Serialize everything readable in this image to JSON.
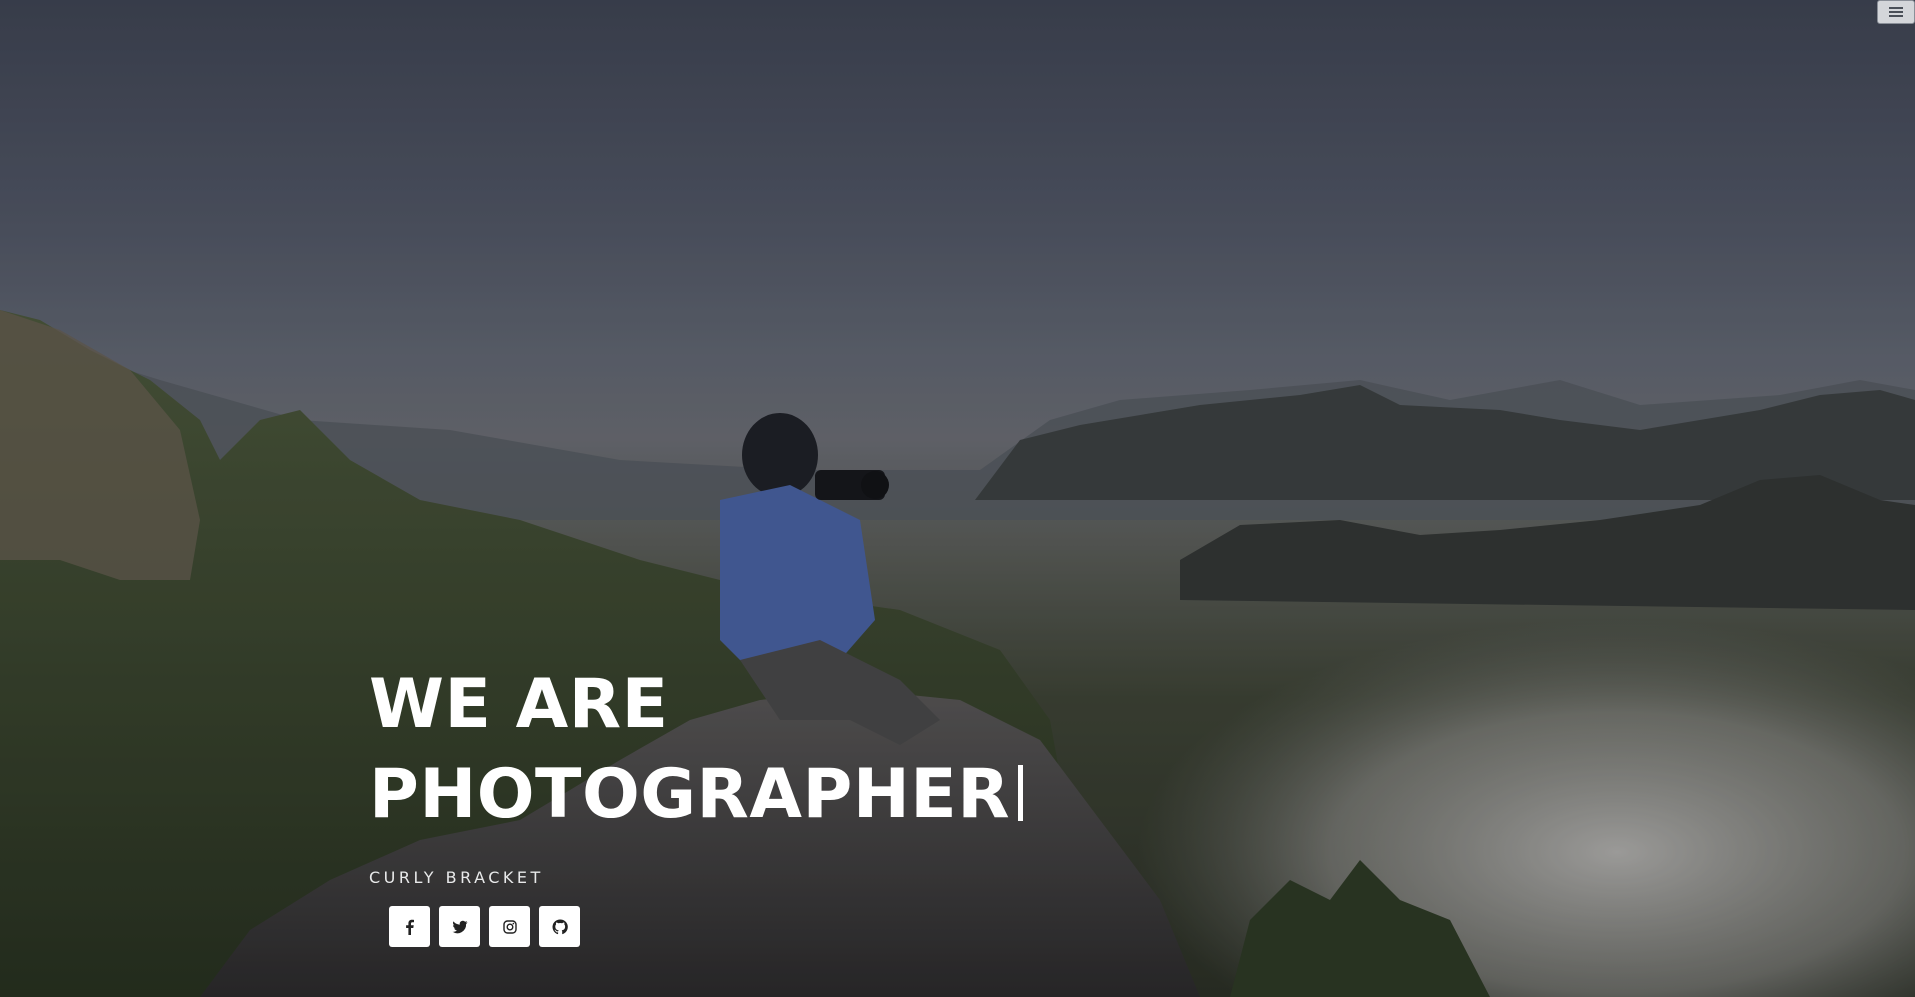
{
  "hero": {
    "headline_line1": "WE ARE",
    "headline_line2": "PHOTOGRAPHER",
    "subtitle": "CURLY BRACKET"
  },
  "nav": {
    "menu_icon": "hamburger-icon"
  },
  "social": [
    {
      "icon": "facebook-icon"
    },
    {
      "icon": "twitter-icon"
    },
    {
      "icon": "instagram-icon"
    },
    {
      "icon": "github-icon"
    }
  ],
  "colors": {
    "text": "#ffffff",
    "button_bg": "#ffffff",
    "icon": "#222222"
  }
}
